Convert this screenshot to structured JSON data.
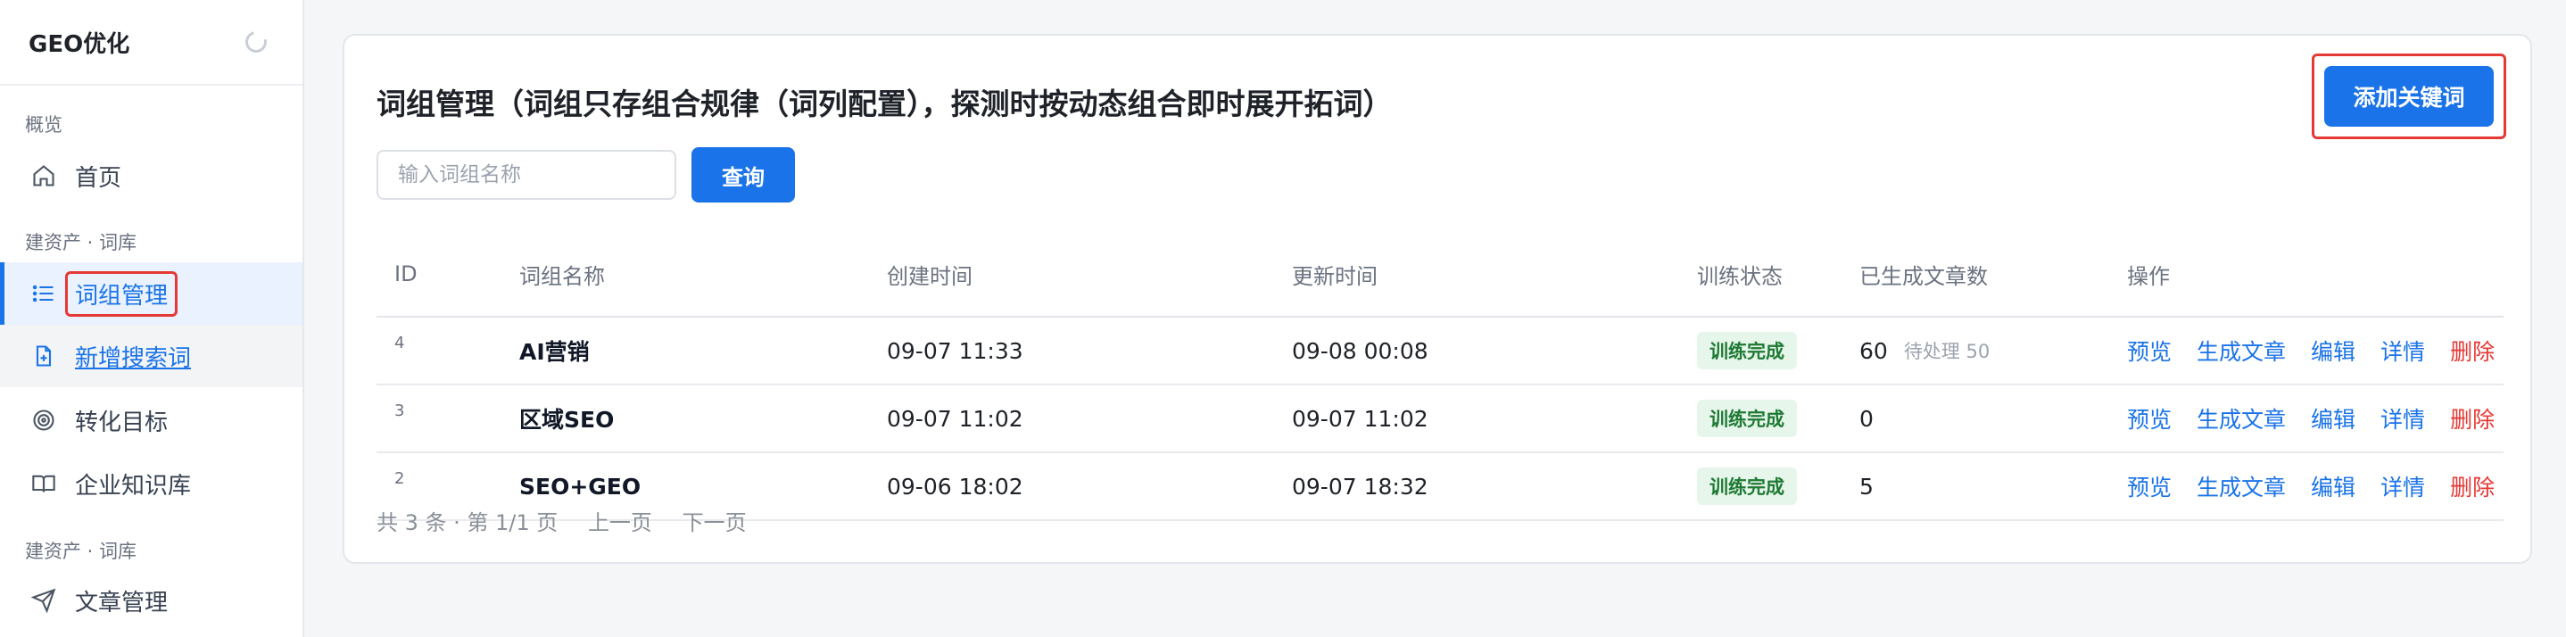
{
  "sidebar": {
    "brand": "GEO优化",
    "sections": [
      "概览",
      "建资产 · 词库",
      "建资产 · 词库"
    ],
    "items": [
      {
        "label": "首页"
      },
      {
        "label": "词组管理"
      },
      {
        "label": "新增搜索词"
      },
      {
        "label": "转化目标"
      },
      {
        "label": "企业知识库"
      },
      {
        "label": "文章管理"
      }
    ]
  },
  "main": {
    "title": "词组管理（词组只存组合规律（词列配置），探测时按动态组合即时展开拓词）",
    "add_button": "添加关键词",
    "search_placeholder": "输入词组名称",
    "query_button": "查询",
    "columns": {
      "id": "ID",
      "name": "词组名称",
      "created": "创建时间",
      "updated": "更新时间",
      "status": "训练状态",
      "count": "已生成文章数",
      "ops": "操作"
    },
    "rows": [
      {
        "id": "4",
        "name": "AI营销",
        "created": "09-07 11:33",
        "updated": "09-08 00:08",
        "status": "训练完成",
        "count": "60",
        "pending": "待处理 50"
      },
      {
        "id": "3",
        "name": "区域SEO",
        "created": "09-07 11:02",
        "updated": "09-07 11:02",
        "status": "训练完成",
        "count": "0",
        "pending": ""
      },
      {
        "id": "2",
        "name": "SEO+GEO",
        "created": "09-06 18:02",
        "updated": "09-07 18:32",
        "status": "训练完成",
        "count": "5",
        "pending": ""
      }
    ],
    "ops": {
      "preview": "预览",
      "generate": "生成文章",
      "edit": "编辑",
      "detail": "详情",
      "delete": "删除"
    },
    "pagination": {
      "summary": "共 3 条 · 第 1/1 页",
      "prev": "上一页",
      "next": "下一页"
    }
  },
  "colors": {
    "accent": "#1a73e8",
    "danger": "#e53935",
    "success_bg": "#e7f6ea",
    "success_text": "#1e7a34"
  }
}
